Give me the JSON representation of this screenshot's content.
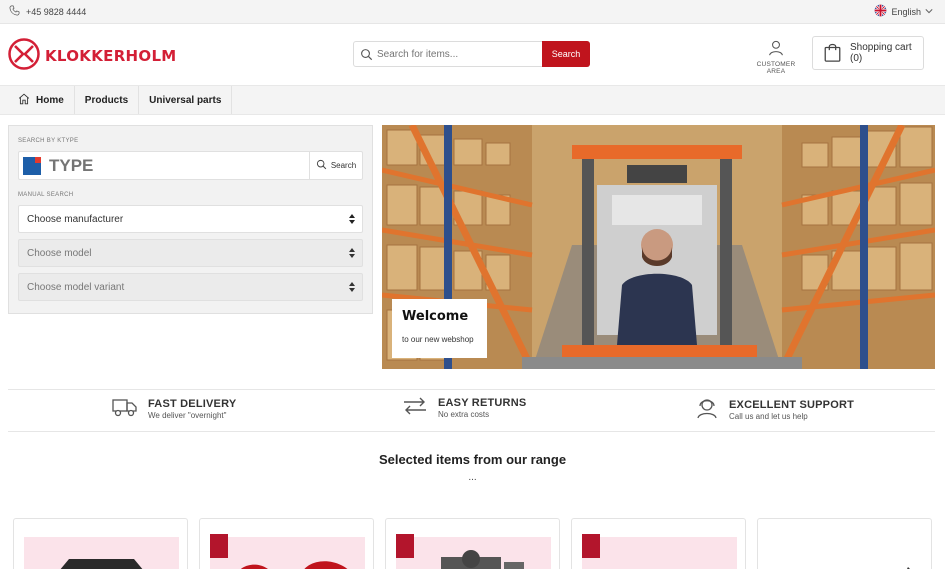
{
  "topbar": {
    "phone": "+45 9828 4444",
    "language": "English"
  },
  "header": {
    "brand": "KLOKKERHOLM",
    "search_placeholder": "Search for items...",
    "search_button": "Search",
    "customer_area": "CUSTOMER AREA",
    "cart": "Shopping cart (0)"
  },
  "nav": {
    "items": [
      "Home",
      "Products",
      "Universal parts"
    ]
  },
  "ktype": {
    "label": "SEARCH BY KTYPE",
    "placeholder": "TYPE",
    "button": "Search",
    "manual_label": "MANUAL SEARCH",
    "manufacturer": "Choose manufacturer",
    "model": "Choose model",
    "variant": "Choose model variant"
  },
  "hero": {
    "title": "Welcome",
    "subtitle": "to our new webshop"
  },
  "benefits": [
    {
      "title": "FAST DELIVERY",
      "desc": "We deliver \"overnight\"",
      "icon": "truck-icon"
    },
    {
      "title": "EASY RETURNS",
      "desc": "No extra costs",
      "icon": "arrows-exchange-icon"
    },
    {
      "title": "EXCELLENT SUPPORT",
      "desc": "Call us and let us help",
      "icon": "support-agent-icon"
    }
  ],
  "section": {
    "title": "Selected items from our range",
    "dots": "..."
  },
  "colors": {
    "brand_red": "#c0141d",
    "logo_red": "#d31f36"
  }
}
